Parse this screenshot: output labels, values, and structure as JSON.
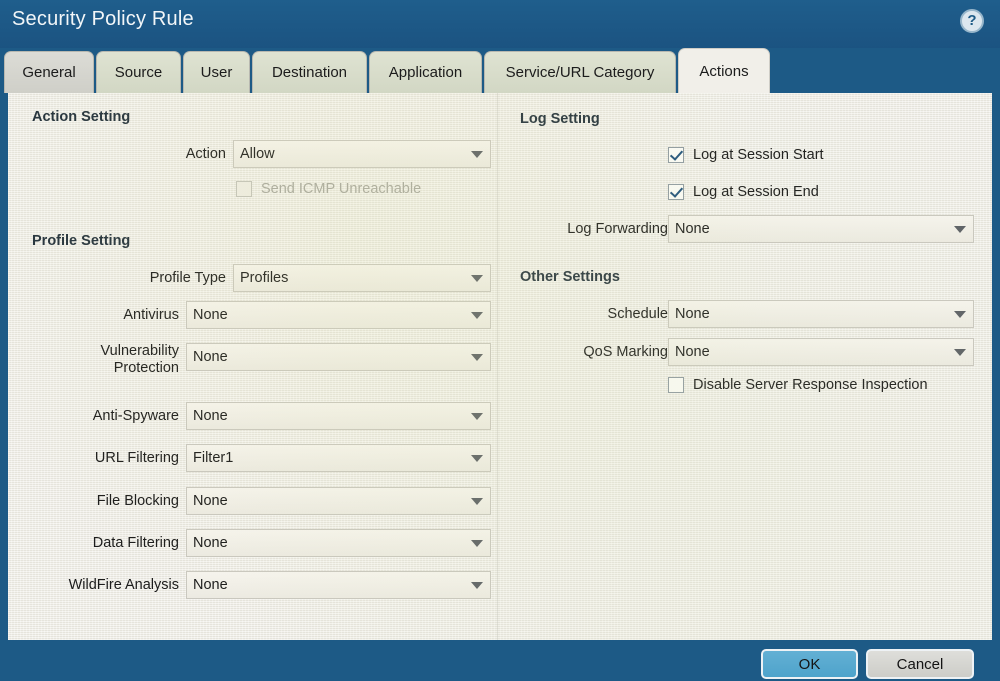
{
  "window": {
    "title": "Security Policy Rule",
    "help_icon": "help-circle-icon",
    "help_glyph": "?"
  },
  "tabs": [
    {
      "label": "General",
      "active": false
    },
    {
      "label": "Source",
      "active": false
    },
    {
      "label": "User",
      "active": false
    },
    {
      "label": "Destination",
      "active": false
    },
    {
      "label": "Application",
      "active": false
    },
    {
      "label": "Service/URL Category",
      "active": false
    },
    {
      "label": "Actions",
      "active": true
    }
  ],
  "left_panel": {
    "action_setting": {
      "title": "Action Setting",
      "action": {
        "label": "Action",
        "value": "Allow"
      },
      "send_icmp": {
        "label": "Send ICMP Unreachable",
        "checked": false,
        "disabled": true
      }
    },
    "profile_setting": {
      "title": "Profile Setting",
      "profile_type": {
        "label": "Profile Type",
        "value": "Profiles"
      },
      "rows": [
        {
          "label": "Antivirus",
          "value": "None"
        },
        {
          "label": "Vulnerability Protection",
          "value": "None"
        },
        {
          "label": "Anti-Spyware",
          "value": "None"
        },
        {
          "label": "URL Filtering",
          "value": "Filter1"
        },
        {
          "label": "File Blocking",
          "value": "None"
        },
        {
          "label": "Data Filtering",
          "value": "None"
        },
        {
          "label": "WildFire Analysis",
          "value": "None"
        }
      ]
    }
  },
  "right_panel": {
    "log_setting": {
      "title": "Log Setting",
      "log_at_session_start": {
        "label": "Log at Session Start",
        "checked": true
      },
      "log_at_session_end": {
        "label": "Log at Session End",
        "checked": true
      },
      "log_forwarding": {
        "label": "Log Forwarding",
        "value": "None"
      }
    },
    "other_settings": {
      "title": "Other Settings",
      "schedule": {
        "label": "Schedule",
        "value": "None"
      },
      "qos_marking": {
        "label": "QoS Marking",
        "value": "None"
      },
      "disable_server_response_inspection": {
        "label": "Disable Server Response Inspection",
        "checked": false
      }
    }
  },
  "footer": {
    "ok_label": "OK",
    "cancel_label": "Cancel"
  },
  "colors": {
    "titlebar": "#1d5a86",
    "content_bg": "#eeece4",
    "active_tab": "#f1efe9",
    "inactive_tab": "#d4d4cd",
    "ok_button": "#4ea3cb",
    "cancel_button": "#d5d5d0",
    "checkmark": "#20527c"
  }
}
